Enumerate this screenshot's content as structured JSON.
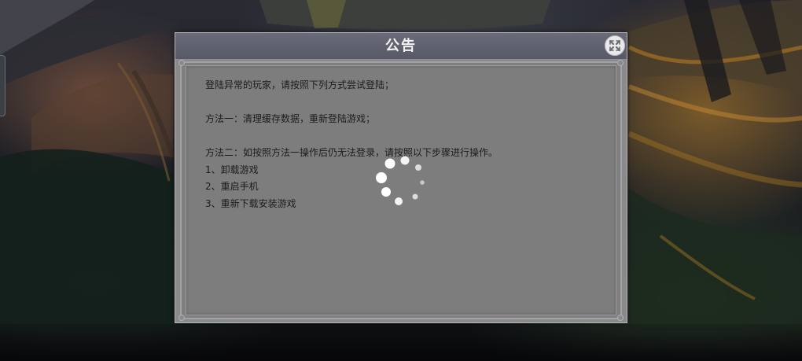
{
  "dialog": {
    "title": "公告",
    "lines": [
      "登陆异常的玩家，请按照下列方式尝试登陆；",
      "",
      "方法一：清理缓存数据，重新登陆游戏；",
      "",
      "方法二：如按照方法一操作后仍无法登录，请按照以下步骤进行操作。",
      "1、卸载游戏",
      "2、重启手机",
      "3、重新下载安装游戏"
    ]
  },
  "icons": {
    "close": "close-icon",
    "spinner": "loading-spinner-icon"
  },
  "colors": {
    "dialog_body": "#8a8a8a",
    "titlebar": "#5f606c",
    "title_text": "#f2f2f4",
    "body_text": "#1c1c1c"
  }
}
